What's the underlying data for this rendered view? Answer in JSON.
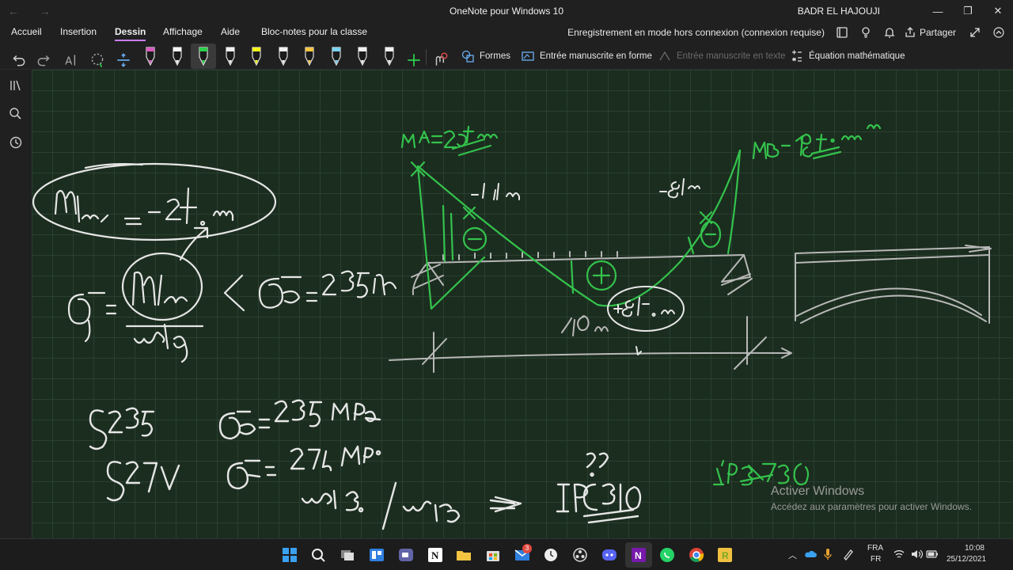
{
  "window": {
    "title": "OneNote pour Windows 10",
    "user": "BADR EL HAJOUJI",
    "controls": {
      "minimize": "—",
      "restore": "❐",
      "close": "✕"
    },
    "nav": {
      "back": "←",
      "forward": "→"
    }
  },
  "ribbon": {
    "tabs": [
      {
        "label": "Accueil"
      },
      {
        "label": "Insertion"
      },
      {
        "label": "Dessin"
      },
      {
        "label": "Affichage"
      },
      {
        "label": "Aide"
      },
      {
        "label": "Bloc-notes pour la classe"
      }
    ],
    "status": "Enregistrement en mode hors connexion (connexion requise)",
    "share_label": "Partager"
  },
  "toolbar": {
    "shapes_label": "Formes",
    "ink_to_shape_label": "Entrée manuscrite en forme",
    "ink_to_text_label": "Entrée manuscrite en texte",
    "math_label": "Équation mathématique",
    "pens": [
      {
        "color": "#d65cc0"
      },
      {
        "color": "#f5f5f5"
      },
      {
        "color": "#2bd14b"
      },
      {
        "color": "#f0f0f0"
      },
      {
        "color": "#f5f51a"
      },
      {
        "color": "#f0f0f0"
      },
      {
        "color": "#f5c542"
      },
      {
        "color": "#7ad3f0"
      },
      {
        "color": "#f0f0f0"
      },
      {
        "color": "#f0f0f0"
      }
    ]
  },
  "watermark": {
    "title": "Activer Windows",
    "subtitle": "Accédez aux paramètres pour activer Windows."
  },
  "taskbar": {
    "lang_top": "FRA",
    "lang_bottom": "FR",
    "time": "10:08",
    "date": "25/12/2021",
    "notification_badge": "3"
  }
}
